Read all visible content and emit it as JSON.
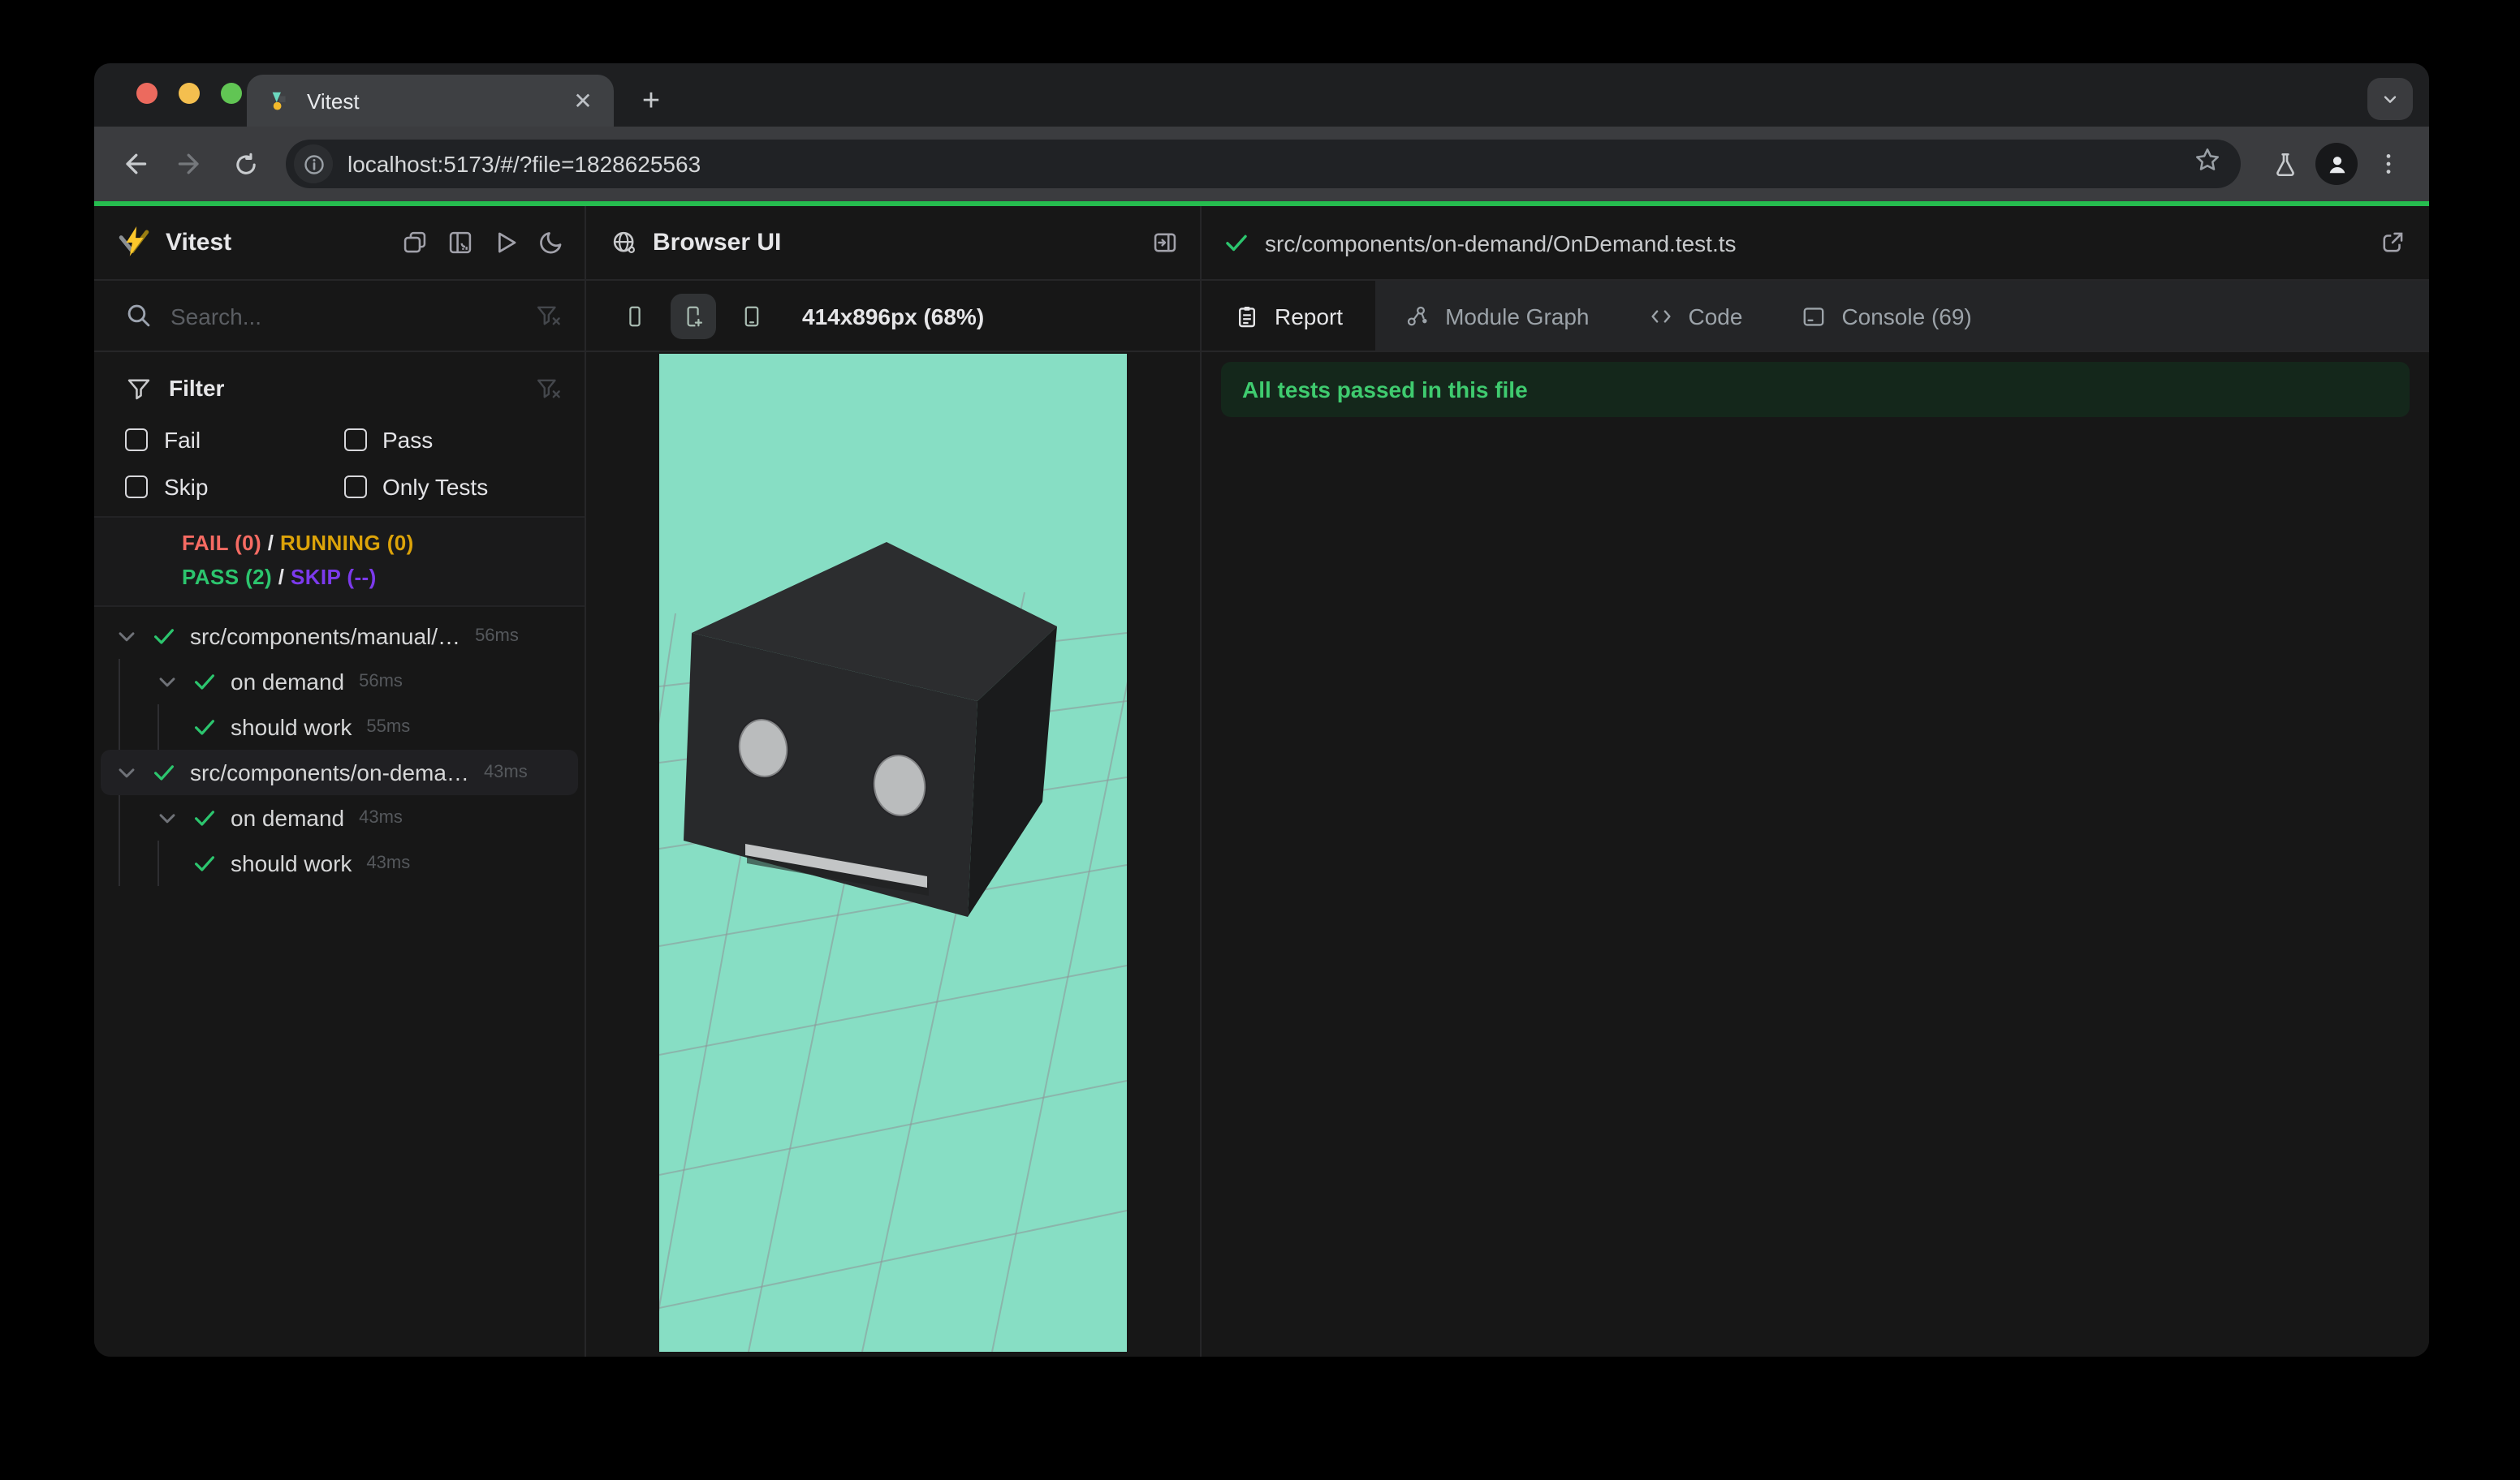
{
  "browser": {
    "tab_title": "Vitest",
    "url": "localhost:5173/#/?file=1828625563",
    "traffic_lights": [
      "close",
      "minimize",
      "zoom"
    ],
    "toolbar_icons": [
      "back-icon",
      "forward-icon",
      "reload-icon",
      "site-info-icon",
      "star-icon",
      "flask-icon",
      "profile-icon",
      "menu-icon"
    ]
  },
  "colors": {
    "progress_green": "#26BD4F",
    "fail_red": "#F66B63",
    "running_amber": "#DCA309",
    "pass_green": "#2CC56E",
    "skip_purple": "#7C3AED",
    "preview_background": "#87DEC4",
    "banner_background": "#14271B",
    "banner_text": "#3FCB6F"
  },
  "sidebar": {
    "app_title": "Vitest",
    "header_icons": [
      "stacked-windows-icon",
      "dashboard-icon",
      "run-all-icon",
      "dark-mode-icon"
    ],
    "search_placeholder": "Search...",
    "filter": {
      "title": "Filter",
      "items": [
        {
          "label": "Fail",
          "checked": false
        },
        {
          "label": "Pass",
          "checked": false
        },
        {
          "label": "Skip",
          "checked": false
        },
        {
          "label": "Only Tests",
          "checked": false
        }
      ]
    },
    "status": {
      "fail": "FAIL (0)",
      "running": "RUNNING (0)",
      "pass": "PASS (2)",
      "skip": "SKIP (--)",
      "sep": "/"
    },
    "tree": {
      "rows": [
        {
          "label": "src/components/manual/…",
          "duration": "56ms",
          "state": "pass",
          "level": "file"
        },
        {
          "label": "on demand",
          "duration": "56ms",
          "state": "pass",
          "level": "suite"
        },
        {
          "label": "should work",
          "duration": "55ms",
          "state": "pass",
          "level": "test"
        },
        {
          "label": "src/components/on-dema…",
          "duration": "43ms",
          "state": "pass",
          "level": "file",
          "selected": true
        },
        {
          "label": "on demand",
          "duration": "43ms",
          "state": "pass",
          "level": "suite"
        },
        {
          "label": "should work",
          "duration": "43ms",
          "state": "pass",
          "level": "test"
        }
      ]
    }
  },
  "preview": {
    "title": "Browser UI",
    "size_label": "414x896px (68%)",
    "device_icons": [
      "phone-small-icon",
      "phone-add-icon",
      "tablet-icon"
    ],
    "active_device_index": 1
  },
  "report": {
    "file_path": "src/components/on-demand/OnDemand.test.ts",
    "tabs": [
      {
        "label": "Report",
        "icon": "report-icon",
        "active": true
      },
      {
        "label": "Module Graph",
        "icon": "module-graph-icon",
        "active": false
      },
      {
        "label": "Code",
        "icon": "code-icon",
        "active": false
      },
      {
        "label": "Console (69)",
        "icon": "console-icon",
        "active": false
      }
    ],
    "banner_text": "All tests passed in this file"
  }
}
